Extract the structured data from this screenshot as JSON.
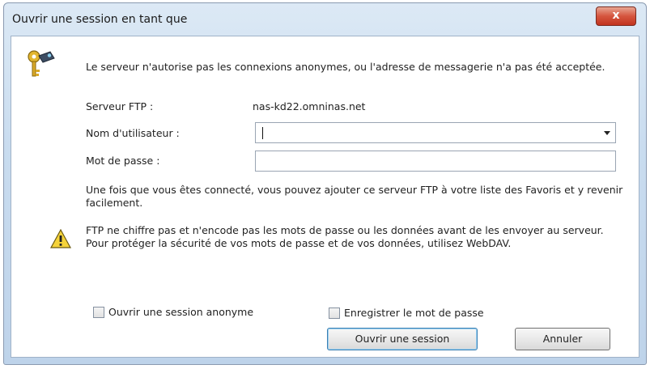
{
  "window": {
    "title": "Ouvrir une session en tant que",
    "close_label": "x"
  },
  "intro_text": "Le serveur n'autorise pas les connexions anonymes, ou l'adresse de messagerie n'a pas été acceptée.",
  "server": {
    "label": "Serveur FTP :",
    "value": "nas-kd22.omninas.net"
  },
  "username": {
    "label": "Nom d'utilisateur :",
    "value": ""
  },
  "password": {
    "label": "Mot de passe :",
    "value": ""
  },
  "info_text": "Une fois que vous êtes connecté, vous pouvez ajouter ce serveur FTP à votre liste des Favoris et y revenir facilement.",
  "warning_text": "FTP ne chiffre pas et n'encode pas les mots de passe ou les données avant de les envoyer au serveur. Pour protéger la sécurité de vos mots de passe et de vos données, utilisez WebDAV.",
  "checkboxes": {
    "anonymous_label": "Ouvrir une session anonyme",
    "anonymous_checked": false,
    "save_password_label": "Enregistrer le mot de passe",
    "save_password_checked": false
  },
  "buttons": {
    "login": "Ouvrir une session",
    "cancel": "Annuler"
  },
  "icons": {
    "keys": "keys-icon",
    "warning": "warning-icon"
  }
}
